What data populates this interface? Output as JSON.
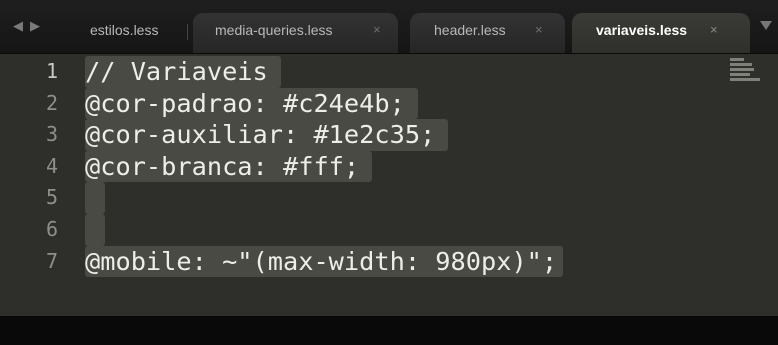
{
  "window": {
    "nav_left_icon": "chevron-left-icon",
    "nav_right_icon": "chevron-right-icon",
    "nav_left_glyph": "◀",
    "nav_right_glyph": "▶",
    "dropdown_icon": "triangle-down-icon"
  },
  "tabs": [
    {
      "label": "estilos.less",
      "close": "",
      "active": false
    },
    {
      "label": "media-queries.less",
      "close": "×",
      "active": false
    },
    {
      "label": "header.less",
      "close": "×",
      "active": false
    },
    {
      "label": "variaveis.less",
      "close": "×",
      "active": true
    }
  ],
  "editor": {
    "lines": [
      {
        "number": "1",
        "text": "// Variaveis"
      },
      {
        "number": "2",
        "text": "@cor-padrao: #c24e4b;"
      },
      {
        "number": "3",
        "text": "@cor-auxiliar: #1e2c35;"
      },
      {
        "number": "4",
        "text": "@cor-branca: #fff;"
      },
      {
        "number": "5",
        "text": ""
      },
      {
        "number": "6",
        "text": ""
      },
      {
        "number": "7",
        "text": "@mobile: ~\"(max-width: 980px)\";"
      }
    ],
    "colors": {
      "background": "#2e2f2a",
      "selection": "#494a44",
      "text": "#eeeee8",
      "line_number": "#8e8f88"
    }
  }
}
